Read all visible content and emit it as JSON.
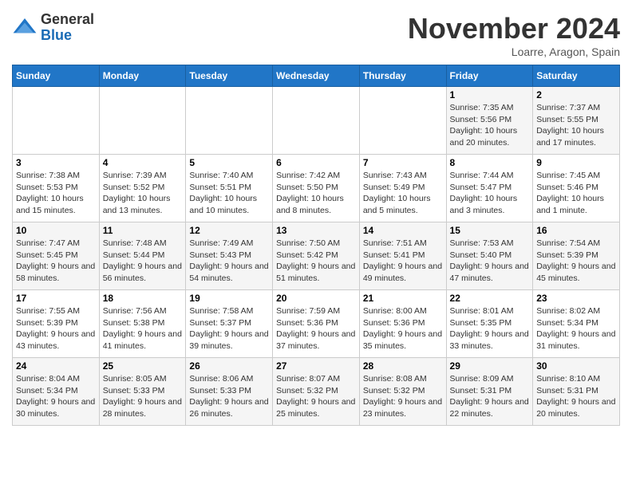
{
  "header": {
    "logo_line1": "General",
    "logo_line2": "Blue",
    "month": "November 2024",
    "location": "Loarre, Aragon, Spain"
  },
  "weekdays": [
    "Sunday",
    "Monday",
    "Tuesday",
    "Wednesday",
    "Thursday",
    "Friday",
    "Saturday"
  ],
  "weeks": [
    [
      {
        "day": "",
        "info": ""
      },
      {
        "day": "",
        "info": ""
      },
      {
        "day": "",
        "info": ""
      },
      {
        "day": "",
        "info": ""
      },
      {
        "day": "",
        "info": ""
      },
      {
        "day": "1",
        "info": "Sunrise: 7:35 AM\nSunset: 5:56 PM\nDaylight: 10 hours and 20 minutes."
      },
      {
        "day": "2",
        "info": "Sunrise: 7:37 AM\nSunset: 5:55 PM\nDaylight: 10 hours and 17 minutes."
      }
    ],
    [
      {
        "day": "3",
        "info": "Sunrise: 7:38 AM\nSunset: 5:53 PM\nDaylight: 10 hours and 15 minutes."
      },
      {
        "day": "4",
        "info": "Sunrise: 7:39 AM\nSunset: 5:52 PM\nDaylight: 10 hours and 13 minutes."
      },
      {
        "day": "5",
        "info": "Sunrise: 7:40 AM\nSunset: 5:51 PM\nDaylight: 10 hours and 10 minutes."
      },
      {
        "day": "6",
        "info": "Sunrise: 7:42 AM\nSunset: 5:50 PM\nDaylight: 10 hours and 8 minutes."
      },
      {
        "day": "7",
        "info": "Sunrise: 7:43 AM\nSunset: 5:49 PM\nDaylight: 10 hours and 5 minutes."
      },
      {
        "day": "8",
        "info": "Sunrise: 7:44 AM\nSunset: 5:47 PM\nDaylight: 10 hours and 3 minutes."
      },
      {
        "day": "9",
        "info": "Sunrise: 7:45 AM\nSunset: 5:46 PM\nDaylight: 10 hours and 1 minute."
      }
    ],
    [
      {
        "day": "10",
        "info": "Sunrise: 7:47 AM\nSunset: 5:45 PM\nDaylight: 9 hours and 58 minutes."
      },
      {
        "day": "11",
        "info": "Sunrise: 7:48 AM\nSunset: 5:44 PM\nDaylight: 9 hours and 56 minutes."
      },
      {
        "day": "12",
        "info": "Sunrise: 7:49 AM\nSunset: 5:43 PM\nDaylight: 9 hours and 54 minutes."
      },
      {
        "day": "13",
        "info": "Sunrise: 7:50 AM\nSunset: 5:42 PM\nDaylight: 9 hours and 51 minutes."
      },
      {
        "day": "14",
        "info": "Sunrise: 7:51 AM\nSunset: 5:41 PM\nDaylight: 9 hours and 49 minutes."
      },
      {
        "day": "15",
        "info": "Sunrise: 7:53 AM\nSunset: 5:40 PM\nDaylight: 9 hours and 47 minutes."
      },
      {
        "day": "16",
        "info": "Sunrise: 7:54 AM\nSunset: 5:39 PM\nDaylight: 9 hours and 45 minutes."
      }
    ],
    [
      {
        "day": "17",
        "info": "Sunrise: 7:55 AM\nSunset: 5:39 PM\nDaylight: 9 hours and 43 minutes."
      },
      {
        "day": "18",
        "info": "Sunrise: 7:56 AM\nSunset: 5:38 PM\nDaylight: 9 hours and 41 minutes."
      },
      {
        "day": "19",
        "info": "Sunrise: 7:58 AM\nSunset: 5:37 PM\nDaylight: 9 hours and 39 minutes."
      },
      {
        "day": "20",
        "info": "Sunrise: 7:59 AM\nSunset: 5:36 PM\nDaylight: 9 hours and 37 minutes."
      },
      {
        "day": "21",
        "info": "Sunrise: 8:00 AM\nSunset: 5:36 PM\nDaylight: 9 hours and 35 minutes."
      },
      {
        "day": "22",
        "info": "Sunrise: 8:01 AM\nSunset: 5:35 PM\nDaylight: 9 hours and 33 minutes."
      },
      {
        "day": "23",
        "info": "Sunrise: 8:02 AM\nSunset: 5:34 PM\nDaylight: 9 hours and 31 minutes."
      }
    ],
    [
      {
        "day": "24",
        "info": "Sunrise: 8:04 AM\nSunset: 5:34 PM\nDaylight: 9 hours and 30 minutes."
      },
      {
        "day": "25",
        "info": "Sunrise: 8:05 AM\nSunset: 5:33 PM\nDaylight: 9 hours and 28 minutes."
      },
      {
        "day": "26",
        "info": "Sunrise: 8:06 AM\nSunset: 5:33 PM\nDaylight: 9 hours and 26 minutes."
      },
      {
        "day": "27",
        "info": "Sunrise: 8:07 AM\nSunset: 5:32 PM\nDaylight: 9 hours and 25 minutes."
      },
      {
        "day": "28",
        "info": "Sunrise: 8:08 AM\nSunset: 5:32 PM\nDaylight: 9 hours and 23 minutes."
      },
      {
        "day": "29",
        "info": "Sunrise: 8:09 AM\nSunset: 5:31 PM\nDaylight: 9 hours and 22 minutes."
      },
      {
        "day": "30",
        "info": "Sunrise: 8:10 AM\nSunset: 5:31 PM\nDaylight: 9 hours and 20 minutes."
      }
    ]
  ]
}
